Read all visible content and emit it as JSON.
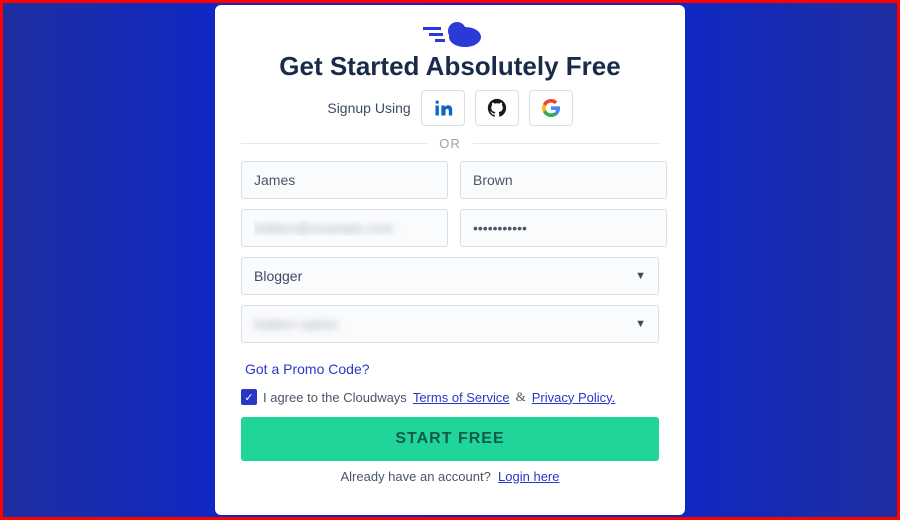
{
  "heading": "Get Started Absolutely Free",
  "social": {
    "label": "Signup Using",
    "providers": [
      "linkedin",
      "github",
      "google"
    ]
  },
  "divider": "OR",
  "form": {
    "first_name": "James",
    "last_name": "Brown",
    "email": "",
    "password": "•••••••••••",
    "role_selected": "Blogger",
    "budget_selected": ""
  },
  "promo_link": "Got a Promo Code?",
  "agree": {
    "checked": true,
    "prefix": "I agree to the Cloudways",
    "tos": "Terms of Service",
    "amp": "&",
    "privacy": "Privacy Policy."
  },
  "cta": "START FREE",
  "footer": {
    "text": "Already have an account?",
    "link": "Login here"
  },
  "colors": {
    "brand": "#2b3ad6",
    "cta_bg": "#1fd59a"
  }
}
